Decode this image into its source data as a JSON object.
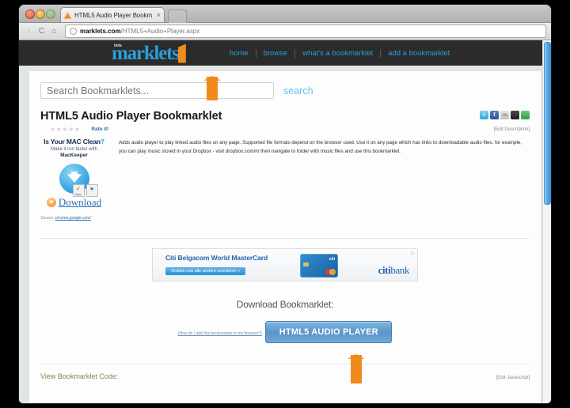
{
  "browser": {
    "tab_title": "HTML5 Audio Player Bookm",
    "tab_close_glyph": "×",
    "back_glyph": "‹",
    "forward_glyph": "›",
    "reload_glyph": "C",
    "home_glyph": "⌂",
    "url_host": "marklets.com",
    "url_path": "/HTML5+Audio+Player.aspx"
  },
  "site": {
    "logo_beta": "beta",
    "logo_word": "marklets",
    "nav": [
      {
        "label": "home"
      },
      {
        "label": "browse"
      },
      {
        "label": "what's a bookmarklet"
      },
      {
        "label": "add a bookmarklet"
      }
    ]
  },
  "search": {
    "placeholder": "Search Bookmarklets...",
    "value": "",
    "button_label": "search"
  },
  "page": {
    "title": "HTML5 Audio Player Bookmarklet",
    "stars": "★★★★★",
    "rate_label": "Rate it!",
    "edit_description_label": "[Edit Description]",
    "description": "Adds audio player to play linked audio files on any page. Supported file formats depend on the browser used. Use it on any page which has links to downloadable audio files, for example, you can play music stored in your Dropbox - visit dropbox.com/m then navigate to folder with music files and use this bookmarklet.",
    "social_icons": [
      {
        "name": "twitter-share-icon",
        "glyph": "t"
      },
      {
        "name": "facebook-share-icon",
        "glyph": "f"
      },
      {
        "name": "stumbleupon-share-icon",
        "glyph": "su"
      },
      {
        "name": "delicious-share-icon",
        "glyph": ""
      },
      {
        "name": "share-more-icon",
        "glyph": ""
      }
    ]
  },
  "left_ad": {
    "headline": "Is Your MAC Clean",
    "headline_mark": "?",
    "subline": "Make it run faster with",
    "brand": "MacKeeper",
    "badge_mac_label": "Mac",
    "badge_mac_glyph": "✓",
    "badge_win_label": "Windows",
    "badge_win_glyph": "●",
    "download_label": "Download",
    "source_prefix": "Source:",
    "source_link": "chrome.google.com/"
  },
  "banner_ad": {
    "title": "Citi Belgacom World MasterCard",
    "cta": "Ontdek ook alle andere voordelen »",
    "card_brand": "citi",
    "logo_bold": "citi",
    "logo_rest": "bank",
    "ad_marker": "▷"
  },
  "download": {
    "heading": "Download Bookmarklet:",
    "help_link": "(How do I add this bookmarklet to my browser?)",
    "button_label": "HTML5 AUDIO PLAYER"
  },
  "footer": {
    "code_label": "View Bookmarklet Code:",
    "edit_js_label": "[Edit Javascript]"
  },
  "colors": {
    "brand_blue": "#2a9fd8",
    "header_dark": "#2b2b2b",
    "annotation_orange": "#f08a1e",
    "page_bg": "#dfe6e4",
    "button_blue": "#5b95c8"
  }
}
